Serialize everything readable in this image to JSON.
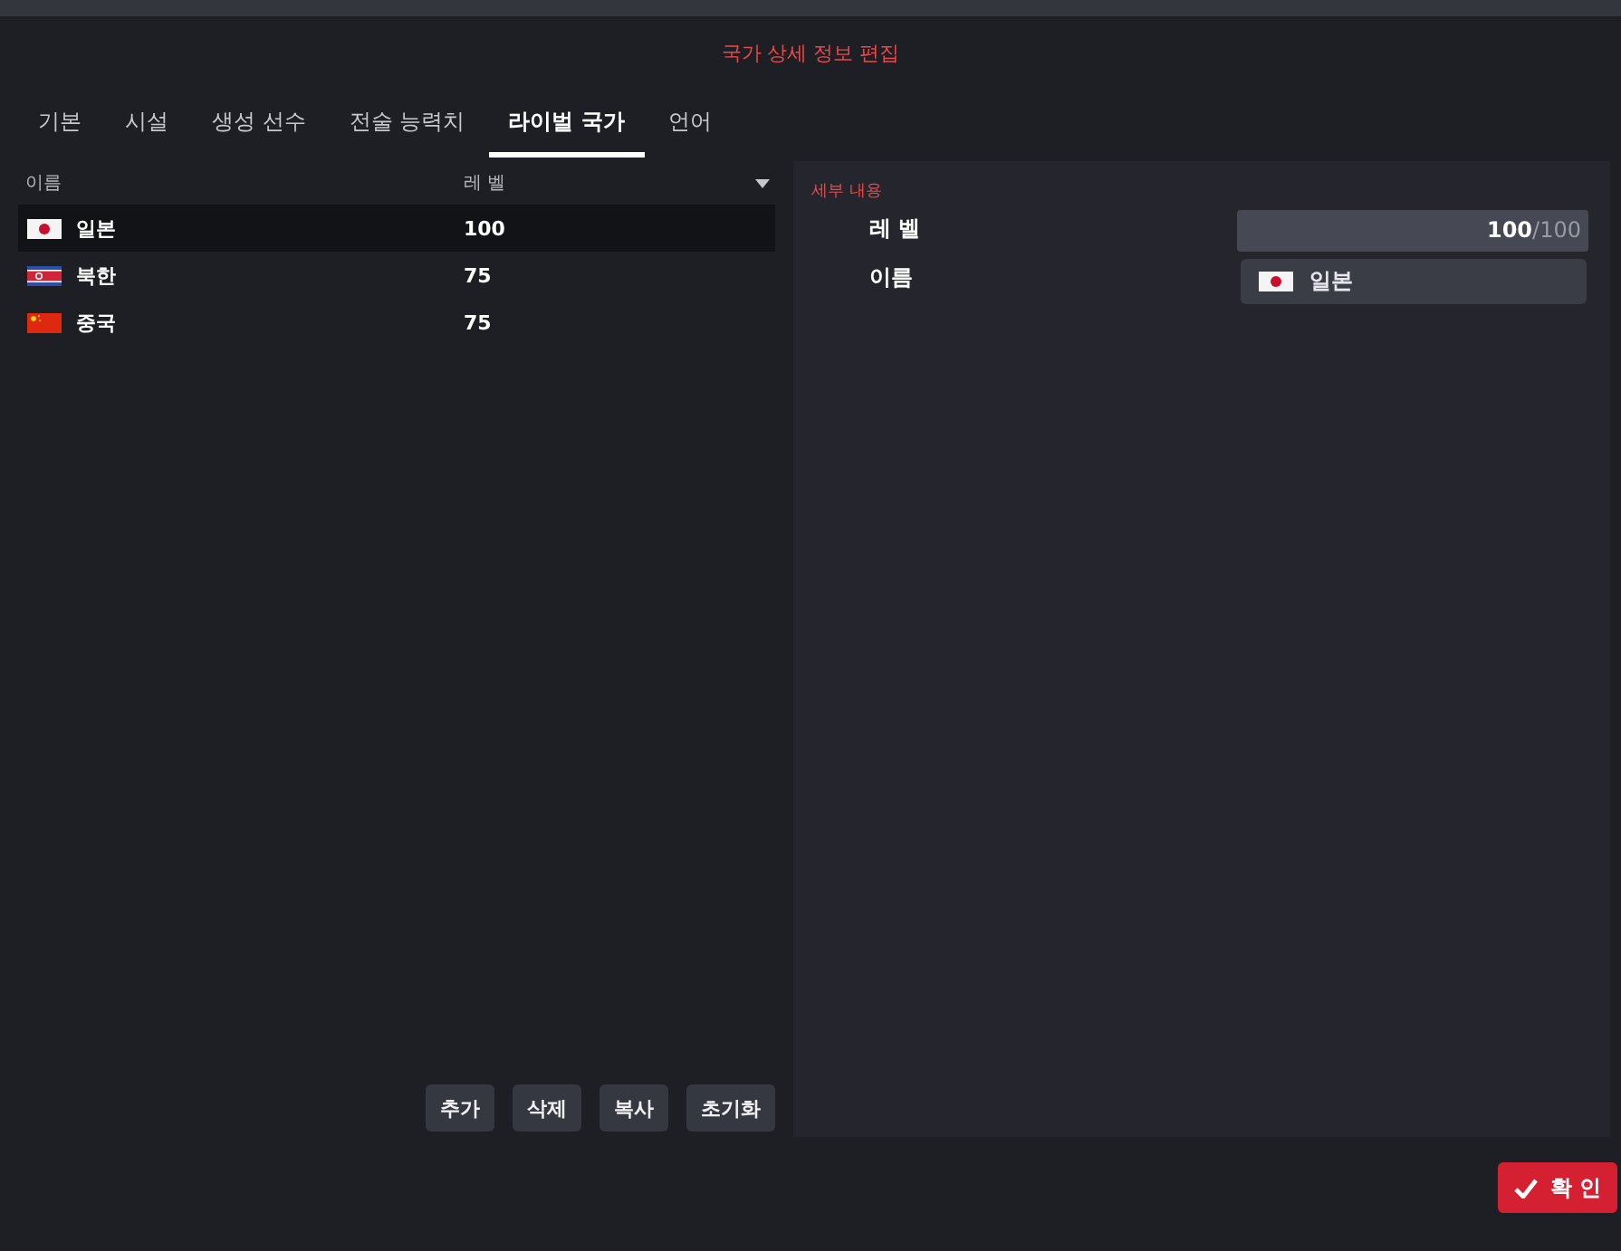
{
  "window": {
    "title": "국가 상세 정보 편집"
  },
  "tabs": [
    {
      "label": "기본",
      "selected": false
    },
    {
      "label": "시설",
      "selected": false
    },
    {
      "label": "생성 선수",
      "selected": false
    },
    {
      "label": "전술 능력치",
      "selected": false
    },
    {
      "label": "라이벌 국가",
      "selected": true
    },
    {
      "label": "언어",
      "selected": false
    }
  ],
  "table": {
    "columns": [
      "이름",
      "레 벨"
    ],
    "rows": [
      {
        "kind": "jp",
        "name": "일본",
        "level": "100",
        "selected": true
      },
      {
        "kind": "kp",
        "name": "북한",
        "level": "75",
        "selected": false
      },
      {
        "kind": "cn",
        "name": "중국",
        "level": "75",
        "selected": false
      }
    ]
  },
  "buttons": [
    "추가",
    "삭제",
    "복사",
    "초기화"
  ],
  "details": {
    "title": "세부 내용",
    "level_label": "레 벨",
    "level_value": "100",
    "level_max": "/100",
    "level": 1,
    "name_label": "이름",
    "name_field": {
      "kind": "jp",
      "value": "일본"
    }
  },
  "confirm": "확 인"
}
